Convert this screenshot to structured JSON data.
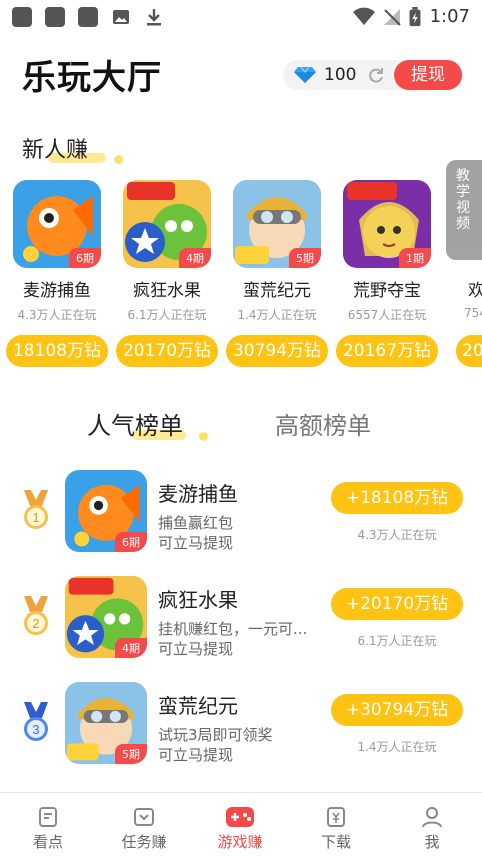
{
  "status_bar": {
    "time": "1:07"
  },
  "header": {
    "title": "乐玩大厅",
    "balance": "100",
    "withdraw_label": "提现"
  },
  "new_user": {
    "title": "新人赚",
    "tutorial_label": "教学视频",
    "games": [
      {
        "name": "麦游捕鱼",
        "period": "6期",
        "players": "4.3万人正在玩",
        "reward": "18108万钻"
      },
      {
        "name": "疯狂水果",
        "period": "4期",
        "players": "6.1万人正在玩",
        "reward": "20170万钻"
      },
      {
        "name": "蛮荒纪元",
        "period": "5期",
        "players": "1.4万人正在玩",
        "reward": "30794万钻"
      },
      {
        "name": "荒野夺宝",
        "period": "1期",
        "players": "6557人正在玩",
        "reward": "20167万钻"
      },
      {
        "name": "欢",
        "period": "",
        "players": "754",
        "reward": "20"
      }
    ]
  },
  "tabs": [
    {
      "label": "人气榜单",
      "active": true
    },
    {
      "label": "高额榜单",
      "active": false
    }
  ],
  "ranking": [
    {
      "rank": "1",
      "name": "麦游捕鱼",
      "period": "6期",
      "desc": "捕鱼赢红包",
      "desc2": "可立马提现",
      "reward": "+18108万钻",
      "players": "4.3万人正在玩",
      "medal_color": "#f0a33a"
    },
    {
      "rank": "2",
      "name": "疯狂水果",
      "period": "4期",
      "desc": "挂机赚红包，一元可...",
      "desc2": "可立马提现",
      "reward": "+20170万钻",
      "players": "6.1万人正在玩",
      "medal_color": "#f0a33a"
    },
    {
      "rank": "3",
      "name": "蛮荒纪元",
      "period": "5期",
      "desc": "试玩3局即可领奖",
      "desc2": "可立马提现",
      "reward": "+30794万钻",
      "players": "1.4万人正在玩",
      "medal_color": "#3a78e6"
    }
  ],
  "bottom_nav": [
    {
      "label": "看点",
      "icon": "news-icon"
    },
    {
      "label": "任务赚",
      "icon": "task-icon"
    },
    {
      "label": "游戏赚",
      "icon": "gamepad-icon",
      "active": true
    },
    {
      "label": "下载",
      "icon": "download-icon"
    },
    {
      "label": "我",
      "icon": "profile-icon"
    }
  ],
  "colors": {
    "accent": "#f44a4a",
    "coin": "#ffc313",
    "highlight": "#ffe066"
  }
}
